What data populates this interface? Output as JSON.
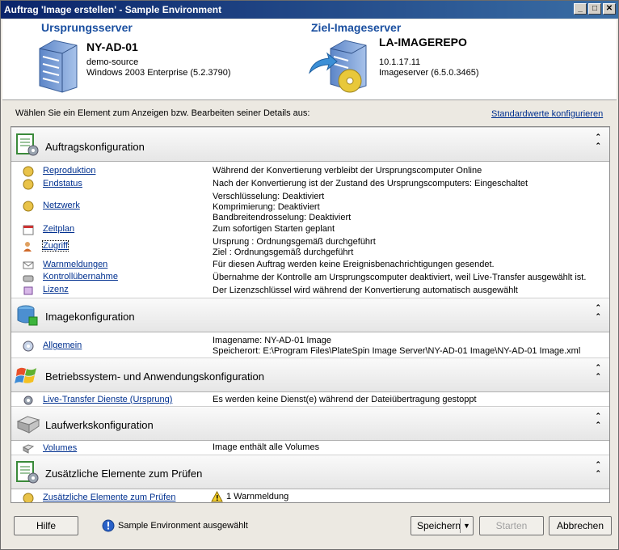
{
  "window": {
    "title": "Auftrag 'Image erstellen' - Sample Environment",
    "min": "_",
    "max": "□",
    "close": "✕"
  },
  "source": {
    "heading": "Ursprungsserver",
    "name": "NY-AD-01",
    "line1": "demo-source",
    "line2": "Windows 2003 Enterprise (5.2.3790)"
  },
  "target": {
    "heading": "Ziel-Imageserver",
    "name": "LA-IMAGEREPO",
    "line1": "10.1.17.11",
    "line2": "Imageserver (6.5.0.3465)"
  },
  "instruction": "Wählen Sie ein Element zum Anzeigen bzw. Bearbeiten seiner Details aus:",
  "defaults_link": "Standardwerte konfigurieren",
  "sections": {
    "job": {
      "title": "Auftragskonfiguration",
      "rows": [
        {
          "link": "Reproduktion",
          "desc": [
            "Während der Konvertierung verbleibt der Ursprungscomputer Online"
          ]
        },
        {
          "link": "Endstatus",
          "desc": [
            "Nach der Konvertierung ist der Zustand des Ursprungscomputers: Eingeschaltet"
          ]
        },
        {
          "link": "Netzwerk",
          "desc": [
            "Verschlüsselung: Deaktiviert",
            "Komprimierung: Deaktiviert",
            "Bandbreitendrosselung: Deaktiviert"
          ]
        },
        {
          "link": "Zeitplan",
          "desc": [
            "Zum sofortigen Starten geplant"
          ]
        },
        {
          "link": "Zugriff",
          "desc": [
            "Ursprung : Ordnungsgemäß durchgeführt",
            "Ziel : Ordnungsgemäß durchgeführt"
          ]
        },
        {
          "link": "Warnmeldungen",
          "desc": [
            "Für diesen Auftrag werden keine Ereignisbenachrichtigungen gesendet."
          ]
        },
        {
          "link": "Kontrollübernahme",
          "desc": [
            "Übernahme der Kontrolle am Ursprungscomputer deaktiviert, weil Live-Transfer ausgewählt ist."
          ]
        },
        {
          "link": "Lizenz",
          "desc": [
            "Der Lizenzschlüssel wird während der Konvertierung automatisch ausgewählt"
          ]
        }
      ]
    },
    "image": {
      "title": "Imagekonfiguration",
      "rows": [
        {
          "link": "Allgemein",
          "desc": [
            "Imagename: NY-AD-01 Image",
            "Speicherort:  E:\\Program Files\\PlateSpin Image Server\\NY-AD-01 Image\\NY-AD-01 Image.xml"
          ]
        }
      ]
    },
    "os": {
      "title": "Betriebssystem- und Anwendungskonfiguration",
      "rows": [
        {
          "link": "Live-Transfer Dienste (Ursprung)",
          "desc": [
            "Es werden keine Dienst(e) während der Dateiübertragung gestoppt"
          ]
        }
      ]
    },
    "drives": {
      "title": "Laufwerkskonfiguration",
      "rows": [
        {
          "link": "Volumes",
          "desc": [
            "Image enthält alle Volumes"
          ]
        }
      ]
    },
    "extra": {
      "title": "Zusätzliche Elemente zum Prüfen",
      "rows": [
        {
          "link": "Zusätzliche Elemente zum Prüfen",
          "desc": [
            "1 Warnmeldung"
          ]
        }
      ]
    }
  },
  "footer": {
    "help": "Hilfe",
    "status": "Sample Environment ausgewählt",
    "save": "Speichern",
    "start": "Starten",
    "cancel": "Abbrechen"
  },
  "colors": {
    "link": "#00308f",
    "heading": "#1a4fa0",
    "titlebar": "#0a246a"
  }
}
